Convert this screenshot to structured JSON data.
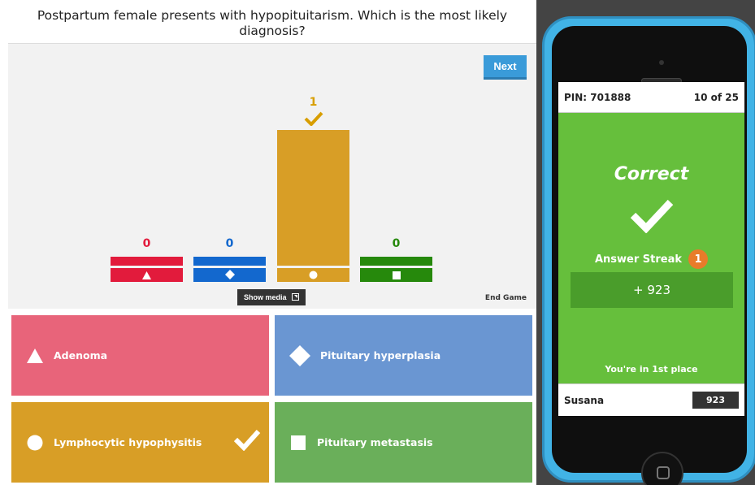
{
  "question": "Postpartum female presents with hypopituitarism. Which is the most likely diagnosis?",
  "controls": {
    "next_label": "Next",
    "show_media_label": "Show media",
    "end_game_label": "End Game"
  },
  "colors": {
    "red": "#e21b3c",
    "blue": "#1368ce",
    "yellow": "#d89e00",
    "green": "#26890c"
  },
  "results": [
    {
      "shape": "triangle-icon",
      "count": "0",
      "color": "#e21b3c"
    },
    {
      "shape": "diamond-icon",
      "count": "0",
      "color": "#1368ce"
    },
    {
      "shape": "circle-icon",
      "count": "1",
      "color": "#d89e00",
      "correct": true
    },
    {
      "shape": "square-icon",
      "count": "0",
      "color": "#26890c"
    }
  ],
  "answers": [
    {
      "label": "Adenoma",
      "shape": "triangle-icon",
      "color": "#e8647a"
    },
    {
      "label": "Pituitary hyperplasia",
      "shape": "diamond-icon",
      "color": "#6a96d2"
    },
    {
      "label": "Lymphocytic hypophysitis",
      "shape": "circle-icon",
      "color": "#d89e26",
      "correct": true
    },
    {
      "label": "Pituitary metastasis",
      "shape": "square-icon",
      "color": "#6aaf5a"
    }
  ],
  "phone": {
    "pin": "PIN: 701888",
    "progress": "10 of 25",
    "result": "Correct",
    "streak_label": "Answer Streak",
    "streak_count": "1",
    "points": "+ 923",
    "place_prefix": "You're in ",
    "place_rank": "1st",
    "place_suffix": " place",
    "player_name": "Susana",
    "score": "923"
  }
}
